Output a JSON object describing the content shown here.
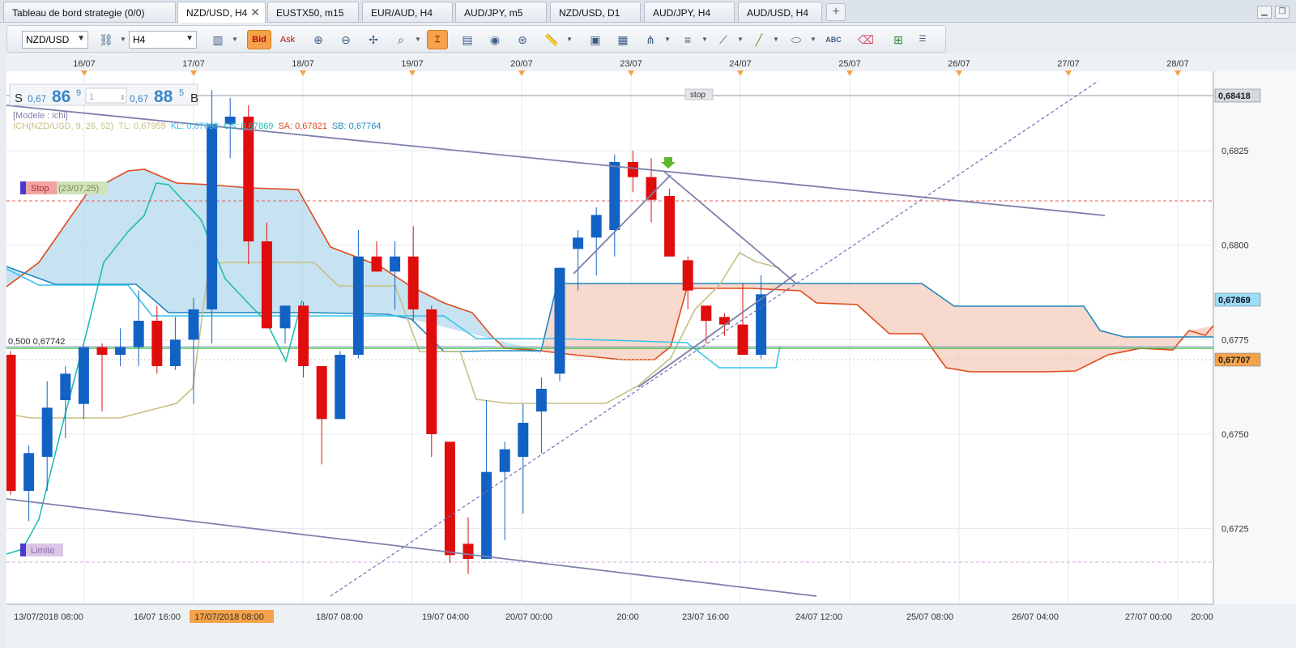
{
  "tabs": [
    {
      "label": "Tableau de bord strategie (0/0)",
      "active": false
    },
    {
      "label": "NZD/USD, H4",
      "active": true
    },
    {
      "label": "EUSTX50, m15",
      "active": false
    },
    {
      "label": "EUR/AUD, H4",
      "active": false
    },
    {
      "label": "AUD/JPY, m5",
      "active": false
    },
    {
      "label": "NZD/USD, D1",
      "active": false
    },
    {
      "label": "AUD/JPY, H4",
      "active": false
    },
    {
      "label": "AUD/USD, H4",
      "active": false
    }
  ],
  "toolbar": {
    "symbol": "NZD/USD",
    "timeframe": "H4",
    "bid_label": "Bid",
    "ask_label": "Ask",
    "text_tool_label": "ABC"
  },
  "quote": {
    "sell_label": "S",
    "sell_big": "0,67",
    "sell_pips": "86",
    "sell_frac": "9",
    "amount": "1",
    "buy_big": "0,67",
    "buy_pips": "88",
    "buy_frac": "5",
    "buy_label": "B"
  },
  "indicator": {
    "model": "[Modele : ichi]",
    "ich": "ICH(NZD/USD, 9, 26, 52)",
    "tl": "TL: 0,67959",
    "kl": "KL: 0,67683",
    "cs": "CS: 0,67869",
    "sa": "SA: 0,67821",
    "sb": "SB: 0,67764"
  },
  "orders": {
    "stop_label": "Stop",
    "stop_date": "(23/07,25)",
    "limit_label": "Limite",
    "stop_line_label": "stop",
    "fib_label": "0,500 0,67742"
  },
  "top_dates": [
    "16/07",
    "17/07",
    "18/07",
    "19/07",
    "20/07",
    "23/07",
    "24/07",
    "25/07",
    "26/07",
    "27/07",
    "28/07"
  ],
  "bottom_dates": [
    "13/07/2018 08:00",
    "16/07 16:00",
    "17/07/2018 08:00",
    "18/07 08:00",
    "19/07 04:00",
    "20/07 00:00",
    "20:00",
    "23/07 16:00",
    "24/07 12:00",
    "25/07 08:00",
    "26/07 04:00",
    "27/07 00:00",
    "20:00"
  ],
  "price_labels": [
    "0,6825",
    "0,6800",
    "0,6775",
    "0,6750",
    "0,6725"
  ],
  "price_tags": [
    {
      "text": "0,68418",
      "style": "gray"
    },
    {
      "text": "0,67869",
      "style": "blue"
    },
    {
      "text": "0,67707",
      "style": "orange"
    }
  ],
  "colors": {
    "bull": "#1262c4",
    "bear": "#e00d0d",
    "kumo_bull": "#b9dbed",
    "kumo_bear": "#f6d2c4",
    "tenkan": "#c8bf84",
    "kijun": "#35c4ec",
    "chikou": "#22bcb4",
    "span_a": "#e24a1c",
    "span_b": "#1e88c0",
    "trendline": "#7d7fac",
    "accent_orange": "#f5a24a"
  },
  "chart_data": {
    "type": "candlestick",
    "instrument": "NZD/USD",
    "timeframe": "H4",
    "ylim": [
      0.6705,
      0.6846
    ],
    "candles": [
      {
        "o": 0.6771,
        "h": 0.6772,
        "l": 0.6734,
        "c": 0.6735
      },
      {
        "o": 0.6735,
        "h": 0.6747,
        "l": 0.6727,
        "c": 0.6745
      },
      {
        "o": 0.6744,
        "h": 0.6764,
        "l": 0.6735,
        "c": 0.6757
      },
      {
        "o": 0.6759,
        "h": 0.6768,
        "l": 0.6749,
        "c": 0.6766
      },
      {
        "o": 0.6758,
        "h": 0.6773,
        "l": 0.6754,
        "c": 0.6773
      },
      {
        "o": 0.6773,
        "h": 0.6774,
        "l": 0.6756,
        "c": 0.6771
      },
      {
        "o": 0.6771,
        "h": 0.6778,
        "l": 0.6768,
        "c": 0.6773
      },
      {
        "o": 0.6773,
        "h": 0.6788,
        "l": 0.6768,
        "c": 0.678
      },
      {
        "o": 0.678,
        "h": 0.6784,
        "l": 0.6766,
        "c": 0.6768
      },
      {
        "o": 0.6768,
        "h": 0.6781,
        "l": 0.6767,
        "c": 0.6775
      },
      {
        "o": 0.6775,
        "h": 0.6786,
        "l": 0.6758,
        "c": 0.6783
      },
      {
        "o": 0.6783,
        "h": 0.6841,
        "l": 0.6774,
        "c": 0.6832
      },
      {
        "o": 0.6832,
        "h": 0.6839,
        "l": 0.6823,
        "c": 0.6834
      },
      {
        "o": 0.6834,
        "h": 0.6837,
        "l": 0.6795,
        "c": 0.6801
      },
      {
        "o": 0.6801,
        "h": 0.6806,
        "l": 0.6778,
        "c": 0.6778
      },
      {
        "o": 0.6778,
        "h": 0.6784,
        "l": 0.6774,
        "c": 0.6784
      },
      {
        "o": 0.6784,
        "h": 0.6785,
        "l": 0.6765,
        "c": 0.6768
      },
      {
        "o": 0.6768,
        "h": 0.6768,
        "l": 0.6742,
        "c": 0.6754
      },
      {
        "o": 0.6754,
        "h": 0.6772,
        "l": 0.6754,
        "c": 0.6771
      },
      {
        "o": 0.6771,
        "h": 0.6804,
        "l": 0.677,
        "c": 0.6797
      },
      {
        "o": 0.6797,
        "h": 0.6801,
        "l": 0.6793,
        "c": 0.6793
      },
      {
        "o": 0.6793,
        "h": 0.6801,
        "l": 0.6783,
        "c": 0.6797
      },
      {
        "o": 0.6797,
        "h": 0.6805,
        "l": 0.678,
        "c": 0.6783
      },
      {
        "o": 0.6783,
        "h": 0.6784,
        "l": 0.6744,
        "c": 0.675
      },
      {
        "o": 0.6748,
        "h": 0.6748,
        "l": 0.6716,
        "c": 0.6718
      },
      {
        "o": 0.6721,
        "h": 0.6728,
        "l": 0.6713,
        "c": 0.6717
      },
      {
        "o": 0.6717,
        "h": 0.6759,
        "l": 0.6717,
        "c": 0.674
      },
      {
        "o": 0.674,
        "h": 0.6748,
        "l": 0.6722,
        "c": 0.6746
      },
      {
        "o": 0.6744,
        "h": 0.6758,
        "l": 0.6729,
        "c": 0.6753
      },
      {
        "o": 0.6756,
        "h": 0.6765,
        "l": 0.6745,
        "c": 0.6762
      },
      {
        "o": 0.6766,
        "h": 0.6794,
        "l": 0.6764,
        "c": 0.6794
      },
      {
        "o": 0.6799,
        "h": 0.6804,
        "l": 0.6788,
        "c": 0.6802
      },
      {
        "o": 0.6802,
        "h": 0.681,
        "l": 0.6792,
        "c": 0.6808
      },
      {
        "o": 0.6804,
        "h": 0.6824,
        "l": 0.6797,
        "c": 0.6822
      },
      {
        "o": 0.6822,
        "h": 0.6825,
        "l": 0.6814,
        "c": 0.6818
      },
      {
        "o": 0.6818,
        "h": 0.6823,
        "l": 0.6806,
        "c": 0.6812
      },
      {
        "o": 0.6813,
        "h": 0.6815,
        "l": 0.6797,
        "c": 0.6797
      },
      {
        "o": 0.6796,
        "h": 0.6797,
        "l": 0.6783,
        "c": 0.6788
      },
      {
        "o": 0.6784,
        "h": 0.6784,
        "l": 0.6774,
        "c": 0.678
      },
      {
        "o": 0.6781,
        "h": 0.6782,
        "l": 0.6776,
        "c": 0.6779
      },
      {
        "o": 0.6779,
        "h": 0.679,
        "l": 0.6771,
        "c": 0.6771
      },
      {
        "o": 0.6771,
        "h": 0.6792,
        "l": 0.677,
        "c": 0.6787
      }
    ]
  }
}
